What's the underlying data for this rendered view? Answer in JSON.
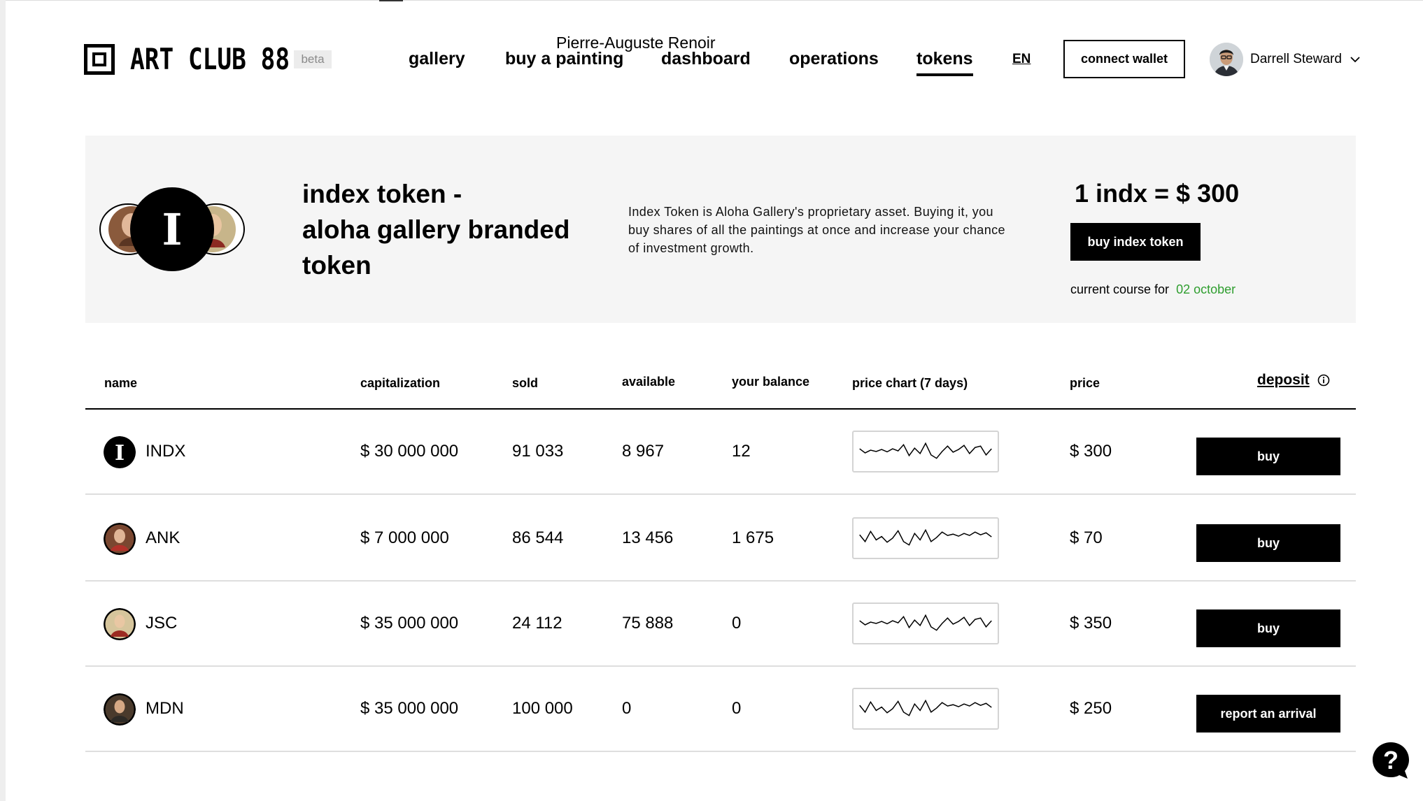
{
  "brand": {
    "name": "ART CLUB 88",
    "badge": "beta"
  },
  "nav": {
    "items": [
      {
        "label": "gallery"
      },
      {
        "label": "buy a painting"
      },
      {
        "label": "dashboard"
      },
      {
        "label": "operations"
      },
      {
        "label": "tokens",
        "active": true
      }
    ],
    "tooltip": "Pierre-Auguste Renoir",
    "language": "EN",
    "connect_wallet": "connect wallet"
  },
  "user": {
    "name": "Darrell Steward"
  },
  "banner": {
    "coin_letter": "I",
    "title_lines": [
      "index token -",
      "aloha gallery branded",
      "token"
    ],
    "description": "Index Token is Aloha Gallery's proprietary asset. Buying it, you buy shares of all the paintings at once and increase your chance of investment growth.",
    "rate": "1 indx = $ 300",
    "buy_button": "buy index token",
    "course_label": "current course for",
    "course_date": "02 october"
  },
  "table": {
    "headers": {
      "name": "name",
      "capitalization": "capitalization",
      "sold": "sold",
      "available": "available",
      "balance": "your balance",
      "chart": "price chart (7 days)",
      "price": "price",
      "deposit": "deposit"
    },
    "rows": [
      {
        "name": "INDX",
        "capitalization": "$ 30 000 000",
        "sold": "91 033",
        "available": "8 967",
        "balance": "12",
        "price": "$ 300",
        "action": "buy",
        "trend": [
          58,
          46,
          54,
          50,
          56,
          49,
          58,
          52,
          70,
          38,
          60,
          44,
          74,
          40,
          30,
          50,
          66,
          48,
          56,
          68,
          44,
          62,
          66,
          40,
          58
        ]
      },
      {
        "name": "ANK",
        "capitalization": "$ 7 000 000",
        "sold": "86 544",
        "available": "13 456",
        "balance": "1 675",
        "price": "$ 70",
        "action": "buy",
        "trend": [
          60,
          40,
          70,
          45,
          55,
          38,
          50,
          72,
          40,
          30,
          64,
          45,
          74,
          40,
          52,
          68,
          58,
          62,
          56,
          64,
          58,
          68,
          60,
          66,
          54
        ]
      },
      {
        "name": "JSC",
        "capitalization": "$ 35 000 000",
        "sold": "24 112",
        "available": "75 888",
        "balance": "0",
        "price": "$ 350",
        "action": "buy",
        "trend": [
          58,
          46,
          54,
          50,
          56,
          49,
          58,
          52,
          70,
          38,
          60,
          44,
          74,
          40,
          30,
          50,
          66,
          48,
          56,
          68,
          44,
          62,
          66,
          40,
          58
        ]
      },
      {
        "name": "MDN",
        "capitalization": "$ 35 000 000",
        "sold": "100 000",
        "available": "0",
        "balance": "0",
        "price": "$ 250",
        "action": "report an arrival",
        "trend": [
          60,
          40,
          70,
          45,
          55,
          38,
          50,
          72,
          40,
          30,
          64,
          45,
          74,
          40,
          52,
          68,
          58,
          62,
          56,
          64,
          58,
          68,
          60,
          66,
          54
        ]
      }
    ]
  },
  "help": {
    "glyph": "?"
  }
}
